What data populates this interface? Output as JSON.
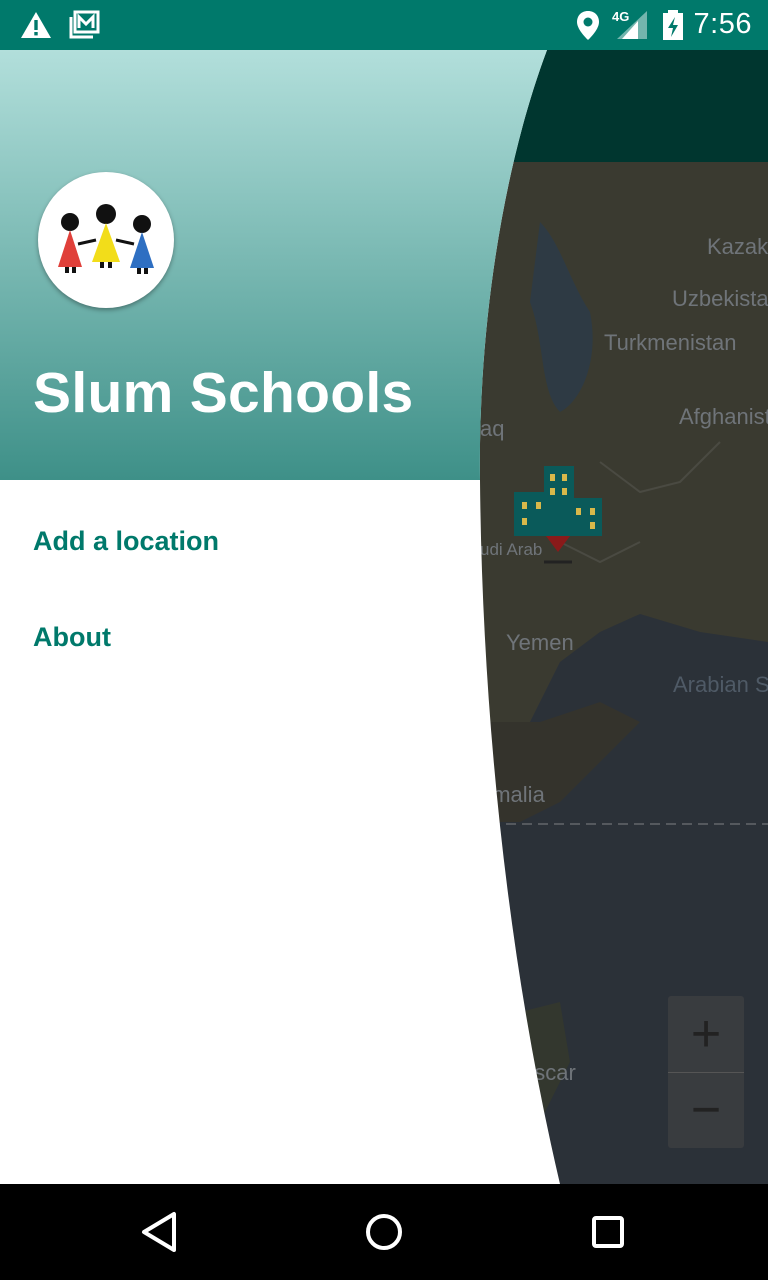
{
  "status_bar": {
    "time": "7:56",
    "network": "4G",
    "icons": [
      "warning-icon",
      "gallery-icon",
      "location-icon",
      "signal-icon",
      "battery-charging-icon"
    ]
  },
  "drawer": {
    "title": "Slum Schools",
    "logo": "children-holding-hands-logo",
    "menu": [
      {
        "label": "Add a location"
      },
      {
        "label": "About"
      }
    ]
  },
  "map": {
    "labels": [
      "Kazak",
      "Uzbekista",
      "Turkmenistan",
      "aq",
      "Afghanist",
      "udi Arab",
      "Yemen",
      "Arabian Se",
      "omalia",
      "ascar"
    ],
    "zoom_in": "+",
    "zoom_out": "−"
  },
  "nav_bar": {
    "icons": [
      "back-icon",
      "home-icon",
      "recents-icon"
    ]
  },
  "colors": {
    "accent": "#00796b",
    "header_top": "#b2dfdb",
    "header_bottom": "#3e9088"
  }
}
